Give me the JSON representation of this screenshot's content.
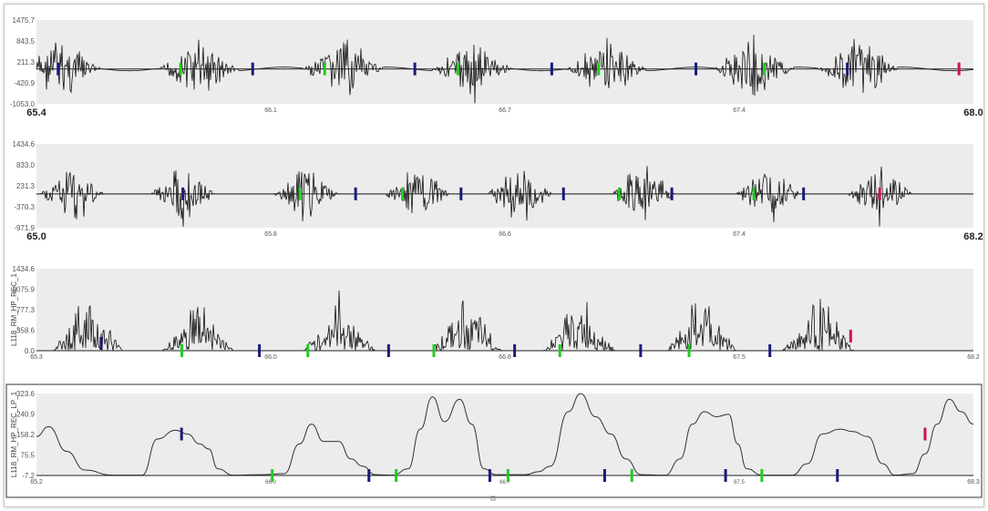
{
  "colors": {
    "plot_bg": "#ececec",
    "trace": "#111111",
    "green": "#22cc22",
    "blue": "#1a1a7a",
    "red": "#d0105a",
    "baseline": "#222222"
  },
  "chart_data": [
    {
      "type": "line",
      "title": "",
      "ylabel": "",
      "ylim": [
        -1053.0,
        1475.7
      ],
      "xlim": [
        65.4,
        68.0
      ],
      "y_ticks": [
        "1475.7",
        "843.5",
        "211.3",
        "-420.9",
        "-1053.0"
      ],
      "x_ticks": [
        "65.4",
        "66.1",
        "66.7",
        "67.4",
        "68.0"
      ],
      "signal": "raw EMG bursts",
      "bursts_x": [
        65.47,
        65.85,
        66.25,
        66.61,
        66.98,
        67.39,
        67.68
      ],
      "markers": [
        {
          "x": 65.46,
          "color": "blue"
        },
        {
          "x": 65.8,
          "color": "green"
        },
        {
          "x": 66.0,
          "color": "blue"
        },
        {
          "x": 66.2,
          "color": "green"
        },
        {
          "x": 66.45,
          "color": "blue"
        },
        {
          "x": 66.57,
          "color": "green"
        },
        {
          "x": 66.83,
          "color": "blue"
        },
        {
          "x": 66.96,
          "color": "green"
        },
        {
          "x": 67.23,
          "color": "blue"
        },
        {
          "x": 67.42,
          "color": "green"
        },
        {
          "x": 67.65,
          "color": "blue"
        },
        {
          "x": 67.96,
          "color": "red"
        }
      ]
    },
    {
      "type": "line",
      "title": "",
      "ylabel": "",
      "ylim": [
        -971.9,
        1434.6
      ],
      "xlim": [
        65.0,
        68.2
      ],
      "y_ticks": [
        "1434.6",
        "833.0",
        "231.3",
        "-370.3",
        "-971.9"
      ],
      "x_ticks": [
        "65.0",
        "65.8",
        "66.6",
        "67.4",
        "68.2"
      ],
      "signal": "high-pass EMG bursts",
      "bursts_x": [
        65.12,
        65.5,
        65.92,
        66.3,
        66.65,
        67.07,
        67.5,
        67.88
      ],
      "markers": [
        {
          "x": 65.5,
          "color": "blue"
        },
        {
          "x": 65.9,
          "color": "green"
        },
        {
          "x": 66.09,
          "color": "blue"
        },
        {
          "x": 66.25,
          "color": "green"
        },
        {
          "x": 66.45,
          "color": "blue"
        },
        {
          "x": 66.8,
          "color": "blue"
        },
        {
          "x": 66.99,
          "color": "green"
        },
        {
          "x": 67.17,
          "color": "blue"
        },
        {
          "x": 67.45,
          "color": "green"
        },
        {
          "x": 67.62,
          "color": "blue"
        },
        {
          "x": 67.88,
          "color": "red"
        }
      ]
    },
    {
      "type": "line",
      "title": "",
      "ylabel": "L118_RM_HP_REC_1",
      "ylim": [
        0.0,
        1434.6
      ],
      "xlim": [
        65.3,
        68.2
      ],
      "y_ticks": [
        "1434.6",
        "1075.9",
        "777.3",
        "358.6",
        "0.0"
      ],
      "x_ticks": [
        "65.3",
        "66.0",
        "66.8",
        "67.5",
        "68.2"
      ],
      "signal": "rectified EMG",
      "bursts_x": [
        65.46,
        65.8,
        66.24,
        66.63,
        66.98,
        67.36,
        67.72
      ],
      "markers": [
        {
          "x": 65.5,
          "color": "blue"
        },
        {
          "x": 65.75,
          "color": "green"
        },
        {
          "x": 65.99,
          "color": "blue"
        },
        {
          "x": 66.14,
          "color": "green"
        },
        {
          "x": 66.39,
          "color": "blue"
        },
        {
          "x": 66.53,
          "color": "green"
        },
        {
          "x": 66.78,
          "color": "blue"
        },
        {
          "x": 66.92,
          "color": "green"
        },
        {
          "x": 67.17,
          "color": "blue"
        },
        {
          "x": 67.32,
          "color": "green"
        },
        {
          "x": 67.57,
          "color": "blue"
        },
        {
          "x": 67.82,
          "color": "red"
        }
      ]
    },
    {
      "type": "line",
      "title": "",
      "ylabel": "L118_RM_HP_REC_LP_1",
      "ylim": [
        -7.2,
        323.6
      ],
      "xlim": [
        65.2,
        68.3
      ],
      "y_ticks": [
        "323.6",
        "240.9",
        "158.2",
        "75.5",
        "-7.2"
      ],
      "x_ticks": [
        "65.2",
        "66.0",
        "66.7",
        "67.5",
        "68.3"
      ],
      "signal": "low-pass envelope",
      "envelope": [
        [
          65.2,
          150
        ],
        [
          65.24,
          190
        ],
        [
          65.3,
          90
        ],
        [
          65.36,
          15
        ],
        [
          65.45,
          -6
        ],
        [
          65.55,
          -6
        ],
        [
          65.6,
          140
        ],
        [
          65.66,
          175
        ],
        [
          65.7,
          160
        ],
        [
          65.74,
          120
        ],
        [
          65.77,
          100
        ],
        [
          65.8,
          20
        ],
        [
          65.85,
          -6
        ],
        [
          65.95,
          -4
        ],
        [
          66.02,
          0
        ],
        [
          66.07,
          120
        ],
        [
          66.11,
          200
        ],
        [
          66.15,
          130
        ],
        [
          66.2,
          130
        ],
        [
          66.24,
          60
        ],
        [
          66.28,
          30
        ],
        [
          66.32,
          -4
        ],
        [
          66.38,
          -6
        ],
        [
          66.43,
          20
        ],
        [
          66.47,
          180
        ],
        [
          66.51,
          310
        ],
        [
          66.55,
          210
        ],
        [
          66.6,
          300
        ],
        [
          66.64,
          200
        ],
        [
          66.68,
          20
        ],
        [
          66.72,
          -4
        ],
        [
          66.82,
          -4
        ],
        [
          66.86,
          8
        ],
        [
          66.9,
          30
        ],
        [
          66.96,
          250
        ],
        [
          67.0,
          323
        ],
        [
          67.05,
          230
        ],
        [
          67.1,
          160
        ],
        [
          67.15,
          60
        ],
        [
          67.2,
          -4
        ],
        [
          67.28,
          -6
        ],
        [
          67.33,
          60
        ],
        [
          67.37,
          200
        ],
        [
          67.41,
          250
        ],
        [
          67.45,
          230
        ],
        [
          67.49,
          240
        ],
        [
          67.52,
          120
        ],
        [
          67.55,
          20
        ],
        [
          67.6,
          -6
        ],
        [
          67.7,
          -6
        ],
        [
          67.75,
          40
        ],
        [
          67.8,
          160
        ],
        [
          67.86,
          180
        ],
        [
          67.9,
          170
        ],
        [
          67.95,
          150
        ],
        [
          68.0,
          40
        ],
        [
          68.04,
          -6
        ],
        [
          68.1,
          0
        ],
        [
          68.14,
          80
        ],
        [
          68.18,
          200
        ],
        [
          68.22,
          300
        ],
        [
          68.26,
          250
        ],
        [
          68.3,
          200
        ]
      ],
      "markers": [
        {
          "x": 65.68,
          "color": "blue"
        },
        {
          "x": 65.98,
          "color": "green"
        },
        {
          "x": 66.3,
          "color": "blue"
        },
        {
          "x": 66.39,
          "color": "green"
        },
        {
          "x": 66.7,
          "color": "blue"
        },
        {
          "x": 66.76,
          "color": "green"
        },
        {
          "x": 67.08,
          "color": "blue"
        },
        {
          "x": 67.17,
          "color": "green"
        },
        {
          "x": 67.48,
          "color": "blue"
        },
        {
          "x": 67.6,
          "color": "green"
        },
        {
          "x": 67.85,
          "color": "blue"
        },
        {
          "x": 68.14,
          "color": "red"
        }
      ]
    }
  ]
}
